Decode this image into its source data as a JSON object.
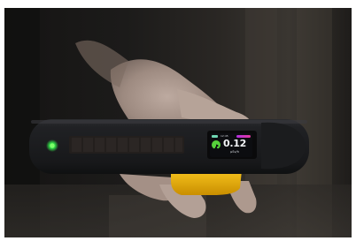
{
  "device": {
    "screen": {
      "time": "12:45",
      "reading": "0.12",
      "unit": "μSv/h",
      "battery_color": "#6fd6b2",
      "dose_bar_colors": [
        "#b12ee0",
        "#e43a9d"
      ],
      "icon": "radiation-icon"
    },
    "power_led_color": "#33e64a",
    "clip_color": "#f2b500"
  }
}
